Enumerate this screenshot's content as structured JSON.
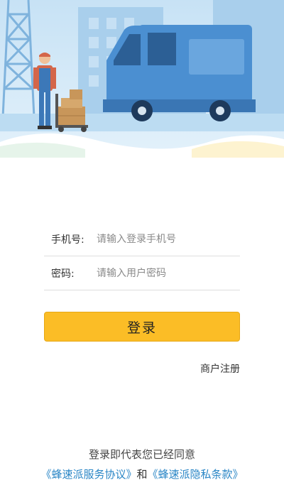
{
  "hero": {
    "illustration": "delivery-truck-and-worker"
  },
  "form": {
    "phone": {
      "label": "手机号:",
      "placeholder": "请输入登录手机号",
      "value": ""
    },
    "password": {
      "label": "密码:",
      "placeholder": "请输入用户密码",
      "value": ""
    }
  },
  "actions": {
    "login_label": "登录",
    "register_label": "商户注册"
  },
  "agreement": {
    "prefix": "登录即代表您已经同意",
    "service_link": "《蜂速派服务协议》",
    "conjunction": "和",
    "privacy_link": "《蜂速派隐私条款》"
  },
  "colors": {
    "accent": "#fbbd26",
    "link": "#2a86c6",
    "truck": "#4b8fd1",
    "sky": "#d6ebf8"
  }
}
